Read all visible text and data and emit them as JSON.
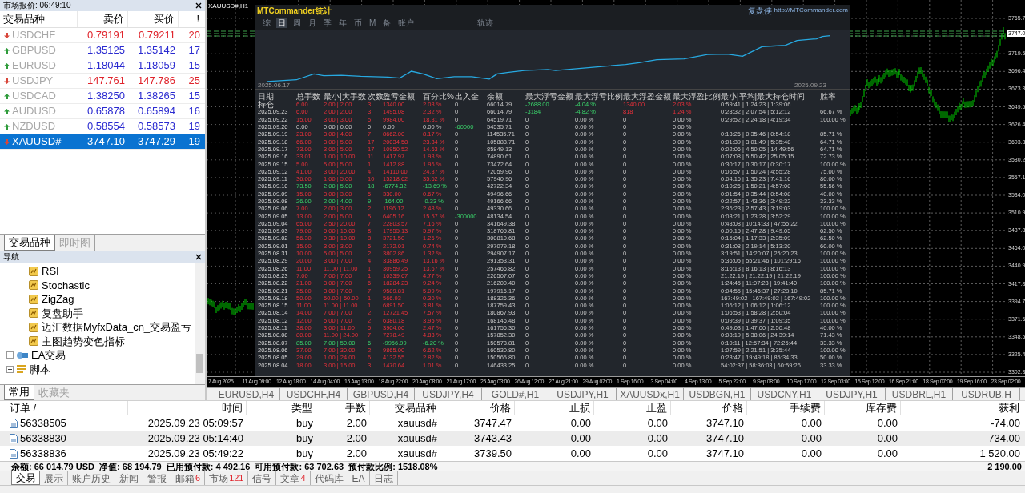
{
  "market_watch": {
    "title": "市场报价: 06:49:10",
    "columns": [
      "交易品种",
      "卖价",
      "买价",
      "!"
    ],
    "rows": [
      {
        "symbol": "USDCHF",
        "bid": "0.79191",
        "ask": "0.79211",
        "spread": "20",
        "rising": false,
        "selected": false
      },
      {
        "symbol": "GBPUSD",
        "bid": "1.35125",
        "ask": "1.35142",
        "spread": "17",
        "rising": true,
        "selected": false
      },
      {
        "symbol": "EURUSD",
        "bid": "1.18044",
        "ask": "1.18059",
        "spread": "15",
        "rising": true,
        "selected": false
      },
      {
        "symbol": "USDJPY",
        "bid": "147.761",
        "ask": "147.786",
        "spread": "25",
        "rising": false,
        "selected": false
      },
      {
        "symbol": "USDCAD",
        "bid": "1.38250",
        "ask": "1.38265",
        "spread": "15",
        "rising": true,
        "selected": false
      },
      {
        "symbol": "AUDUSD",
        "bid": "0.65878",
        "ask": "0.65894",
        "spread": "16",
        "rising": true,
        "selected": false
      },
      {
        "symbol": "NZDUSD",
        "bid": "0.58554",
        "ask": "0.58573",
        "spread": "19",
        "rising": true,
        "selected": false
      },
      {
        "symbol": "XAUUSD#",
        "bid": "3747.10",
        "ask": "3747.29",
        "spread": "19",
        "rising": false,
        "selected": true
      }
    ],
    "tabs": [
      {
        "label": "交易品种",
        "selected": true
      },
      {
        "label": "即时图",
        "selected": false
      }
    ]
  },
  "navigator": {
    "title": "导航",
    "indicators": [
      "RSI",
      "Stochastic",
      "ZigZag",
      "复盘助手",
      "迈汇数据MyfxData_cn_交易盈亏",
      "主图趋势变色指标"
    ],
    "groups": [
      {
        "label": "EA交易",
        "kind": "experts",
        "expanded": false
      },
      {
        "label": "脚本",
        "kind": "scripts",
        "expanded": false
      }
    ],
    "tabs": [
      {
        "label": "常用",
        "selected": true
      },
      {
        "label": "收藏夹",
        "selected": false
      }
    ]
  },
  "chart": {
    "title": "XAUUSD#,H1",
    "current_price": "3747.0",
    "price_labels": [
      "3765.7",
      "3719.5",
      "3696.4",
      "3673.3",
      "3649.5",
      "3626.4",
      "3603.3",
      "3580.2",
      "3557.1",
      "3534.0",
      "3510.9",
      "3487.8",
      "3464.0",
      "3440.9",
      "3417.8",
      "3394.7",
      "3371.6",
      "3348.5",
      "3325.4",
      "3302.3"
    ],
    "time_labels": [
      "7 Aug 2025",
      "11 Aug 09:00",
      "12 Aug 18:00",
      "14 Aug 04:00",
      "15 Aug 13:00",
      "18 Aug 22:00",
      "20 Aug 08:00",
      "21 Aug 17:00",
      "25 Aug 03:00",
      "26 Aug 12:00",
      "27 Aug 21:00",
      "29 Aug 07:00",
      "1 Sep 16:00",
      "3 Sep 04:00",
      "4 Sep 13:00",
      "5 Sep 22:00",
      "9 Sep 08:00",
      "10 Sep 17:00",
      "12 Sep 03:00",
      "15 Sep 12:00",
      "16 Sep 21:00",
      "18 Sep 07:00",
      "19 Sep 16:00",
      "23 Sep 02:00"
    ]
  },
  "stats_panel": {
    "title": "MTCommander统计",
    "brand": "复盘侠",
    "link": "http://MTCommander.com",
    "tabs": [
      {
        "label": "综",
        "selected": false
      },
      {
        "label": "日",
        "selected": true
      },
      {
        "label": "周",
        "selected": false
      },
      {
        "label": "月",
        "selected": false
      },
      {
        "label": "季",
        "selected": false
      },
      {
        "label": "年",
        "selected": false
      },
      {
        "label": "币",
        "selected": false
      },
      {
        "label": "M",
        "selected": false
      },
      {
        "label": "备",
        "selected": false
      },
      {
        "label": "账户",
        "selected": false
      },
      {
        "label": "轨迹",
        "selected": false
      }
    ],
    "curve_start": "2025.06.17",
    "curve_end": "2025.09.23",
    "columns": [
      "日期",
      "总手数",
      "最小|大手数",
      "次数",
      "盈亏金额",
      "百分比%",
      "出入金",
      "余额",
      "最大浮亏金额",
      "最大浮亏比例",
      "最大浮盈金额",
      "最大浮盈比例",
      "最小|平均|最大持仓时间",
      "胜率"
    ],
    "rows": [
      {
        "kind": "gain",
        "floating": true,
        "transfer": false,
        "cells": [
          "持仓",
          "6.00",
          "2.00 | 2.00",
          "3",
          "1340.00",
          "2.03 %",
          "0",
          "66014.79",
          "-2688.00",
          "-4.04 %",
          "1340.00",
          "2.03 %",
          "0:59:41 | 1:24:23 | 1:39:06"
        ]
      },
      {
        "kind": "gain",
        "floating": true,
        "transfer": false,
        "cells": [
          "2025.09.23",
          "6.00",
          "2.00 | 2.00",
          "3",
          "1495.08",
          "2.32 %",
          "0",
          "66014.79",
          "-3184",
          "-4.82 %",
          "818",
          "1.24 %",
          "0:28:32 | 2:07:54 | 5:12:12",
          "66.67 %"
        ]
      },
      {
        "kind": "gain",
        "floating": false,
        "transfer": false,
        "cells": [
          "2025.09.22",
          "15.00",
          "3.00 | 3.00",
          "5",
          "9984.00",
          "18.31 %",
          "0",
          "64519.71",
          "0",
          "0.00 %",
          "0",
          "0.00 %",
          "0:29:52 | 2:24:18 | 4:19:34",
          "100.00 %"
        ]
      },
      {
        "kind": "none",
        "floating": false,
        "transfer": true,
        "cells": [
          "2025.09.20",
          "0.00",
          "0.00 | 0.00",
          "0",
          "0.00",
          "0.00 %",
          "-60000",
          "54535.71",
          "0",
          "0.00 %",
          "0",
          "0.00 %"
        ]
      },
      {
        "kind": "gain",
        "floating": false,
        "transfer": false,
        "cells": [
          "2025.09.19",
          "23.00",
          "3.00 | 4.00",
          "7",
          "8662.00",
          "8.17 %",
          "0",
          "114535.71",
          "0",
          "0.00 %",
          "0",
          "0.00 %",
          "0:13:26 | 0:35:46 | 0:54:18",
          "85.71 %"
        ]
      },
      {
        "kind": "gain",
        "floating": false,
        "transfer": false,
        "cells": [
          "2025.09.18",
          "66.00",
          "3.00 | 5.00",
          "17",
          "20034.58",
          "23.34 %",
          "0",
          "105883.71",
          "0",
          "0.00 %",
          "0",
          "0.00 %",
          "0:01:39 | 3:01:49 | 5:35:48",
          "64.71 %"
        ]
      },
      {
        "kind": "gain",
        "floating": false,
        "transfer": false,
        "cells": [
          "2025.09.17",
          "73.00",
          "3.00 | 5.00",
          "17",
          "10950.52",
          "14.63 %",
          "0",
          "85849.13",
          "0",
          "0.00 %",
          "0",
          "0.00 %",
          "0:02:06 | 4:50:05 | 14:49:56",
          "64.71 %"
        ]
      },
      {
        "kind": "gain",
        "floating": false,
        "transfer": false,
        "cells": [
          "2025.09.16",
          "33.01",
          "1.00 | 10.00",
          "11",
          "1417.97",
          "1.93 %",
          "0",
          "74890.61",
          "0",
          "0.00 %",
          "0",
          "0.00 %",
          "0:07:08 | 5:50:42 | 25:05:15",
          "72.73 %"
        ]
      },
      {
        "kind": "gain",
        "floating": false,
        "transfer": false,
        "cells": [
          "2025.09.15",
          "5.00",
          "5.00 | 5.00",
          "1",
          "1412.88",
          "1.96 %",
          "0",
          "73472.64",
          "0",
          "0.00 %",
          "0",
          "0.00 %",
          "0:30:17 | 0:30:17 | 0:30:17",
          "100.00 %"
        ]
      },
      {
        "kind": "gain",
        "floating": false,
        "transfer": false,
        "cells": [
          "2025.09.12",
          "41.00",
          "3.00 | 20.00",
          "4",
          "14110.00",
          "24.37 %",
          "0",
          "72059.96",
          "0",
          "0.00 %",
          "0",
          "0.00 %",
          "0:06:57 | 1:50:24 | 4:55:28",
          "75.00 %"
        ]
      },
      {
        "kind": "gain",
        "floating": false,
        "transfer": false,
        "cells": [
          "2025.09.11",
          "36.00",
          "1.00 | 5.00",
          "10",
          "15218.62",
          "35.62 %",
          "0",
          "57940.96",
          "0",
          "0.00 %",
          "0",
          "0.00 %",
          "0:04:16 | 1:35:23 | 7:41:16",
          "80.00 %"
        ]
      },
      {
        "kind": "loss",
        "floating": false,
        "transfer": false,
        "cells": [
          "2025.09.10",
          "73.50",
          "2.00 | 5.00",
          "18",
          "-6774.32",
          "-13.69 %",
          "0",
          "42722.34",
          "0",
          "0.00 %",
          "0",
          "0.00 %",
          "0:10:26 | 1:50:21 | 4:57:00",
          "55.56 %"
        ]
      },
      {
        "kind": "gain",
        "floating": false,
        "transfer": false,
        "cells": [
          "2025.09.09",
          "15.00",
          "3.00 | 3.00",
          "5",
          "330.00",
          "0.67 %",
          "0",
          "49496.66",
          "0",
          "0.00 %",
          "0",
          "0.00 %",
          "0:01:54 | 0:35:44 | 0:54:08",
          "40.00 %"
        ]
      },
      {
        "kind": "loss",
        "floating": false,
        "transfer": false,
        "cells": [
          "2025.09.08",
          "26.00",
          "2.00 | 4.00",
          "9",
          "-164.00",
          "-0.33 %",
          "0",
          "49166.66",
          "0",
          "0.00 %",
          "0",
          "0.00 %",
          "0:22:57 | 1:43:36 | 2:49:32",
          "33.33 %"
        ]
      },
      {
        "kind": "gain",
        "floating": false,
        "transfer": false,
        "cells": [
          "2025.09.06",
          "7.00",
          "2.00 | 3.00",
          "2",
          "1196.12",
          "2.48 %",
          "0",
          "49330.66",
          "0",
          "0.00 %",
          "0",
          "0.00 %",
          "2:36:23 | 2:57:43 | 3:19:03",
          "100.00 %"
        ]
      },
      {
        "kind": "gain",
        "floating": false,
        "transfer": true,
        "cells": [
          "2025.09.05",
          "13.00",
          "2.00 | 5.00",
          "5",
          "6405.16",
          "15.57 %",
          "-300000",
          "48134.54",
          "0",
          "0.00 %",
          "0",
          "0.00 %",
          "0:03:21 | 1:23:28 | 3:52:29",
          "100.00 %"
        ]
      },
      {
        "kind": "gain",
        "floating": false,
        "transfer": false,
        "cells": [
          "2025.09.04",
          "65.00",
          "2.50 | 20.00",
          "7",
          "22803.57",
          "7.16 %",
          "0",
          "341649.38",
          "0",
          "0.00 %",
          "0",
          "0.00 %",
          "0:43:08 | 10:14:33 | 47:55:22",
          "100.00 %"
        ]
      },
      {
        "kind": "gain",
        "floating": false,
        "transfer": false,
        "cells": [
          "2025.09.03",
          "79.00",
          "5.00 | 10.00",
          "8",
          "17955.13",
          "5.97 %",
          "0",
          "318765.81",
          "0",
          "0.00 %",
          "0",
          "0.00 %",
          "0:00:15 | 2:47:28 | 9:49:05",
          "62.50 %"
        ]
      },
      {
        "kind": "gain",
        "floating": false,
        "transfer": false,
        "cells": [
          "2025.09.02",
          "56.30",
          "0.30 | 10.00",
          "8",
          "3721.50",
          "1.26 %",
          "0",
          "300810.68",
          "0",
          "0.00 %",
          "0",
          "0.00 %",
          "0:15:04 | 1:17:33 | 2:35:09",
          "62.50 %"
        ]
      },
      {
        "kind": "gain",
        "floating": false,
        "transfer": false,
        "cells": [
          "2025.09.01",
          "15.00",
          "3.00 | 3.00",
          "5",
          "2172.01",
          "0.74 %",
          "0",
          "297079.18",
          "0",
          "0.00 %",
          "0",
          "0.00 %",
          "0:31:08 | 2:19:14 | 5:13:30",
          "60.00 %"
        ]
      },
      {
        "kind": "gain",
        "floating": false,
        "transfer": false,
        "cells": [
          "2025.08.31",
          "10.00",
          "5.00 | 5.00",
          "2",
          "3802.86",
          "1.32 %",
          "0",
          "294907.17",
          "0",
          "0.00 %",
          "0",
          "0.00 %",
          "3:19:51 | 14:20:07 | 25:20:23",
          "100.00 %"
        ]
      },
      {
        "kind": "gain",
        "floating": false,
        "transfer": false,
        "cells": [
          "2025.08.29",
          "20.00",
          "3.00 | 7.00",
          "4",
          "33886.49",
          "13.16 %",
          "0",
          "291353.31",
          "0",
          "0.00 %",
          "0",
          "0.00 %",
          "5:36:05 | 55:21:46 | 101:29:16",
          "100.00 %"
        ]
      },
      {
        "kind": "gain",
        "floating": false,
        "transfer": false,
        "cells": [
          "2025.08.26",
          "11.00",
          "11.00 | 11.00",
          "1",
          "30959.25",
          "13.67 %",
          "0",
          "257466.82",
          "0",
          "0.00 %",
          "0",
          "0.00 %",
          "8:16:13 | 8:16:13 | 8:16:13",
          "100.00 %"
        ]
      },
      {
        "kind": "gain",
        "floating": false,
        "transfer": false,
        "cells": [
          "2025.08.23",
          "7.00",
          "7.00 | 7.00",
          "1",
          "10339.67",
          "4.77 %",
          "0",
          "226507.07",
          "0",
          "0.00 %",
          "0",
          "0.00 %",
          "21:22:19 | 21:22:19 | 21:22:19",
          "100.00 %"
        ]
      },
      {
        "kind": "gain",
        "floating": false,
        "transfer": false,
        "cells": [
          "2025.08.22",
          "21.00",
          "3.00 | 7.00",
          "6",
          "18284.23",
          "9.24 %",
          "0",
          "216200.40",
          "0",
          "0.00 %",
          "0",
          "0.00 %",
          "1:24:45 | 11:07:23 | 19:41:40",
          "100.00 %"
        ]
      },
      {
        "kind": "gain",
        "floating": false,
        "transfer": false,
        "cells": [
          "2025.08.21",
          "25.00",
          "3.00 | 7.00",
          "7",
          "9589.81",
          "5.09 %",
          "0",
          "197916.17",
          "0",
          "0.00 %",
          "0",
          "0.00 %",
          "0:04:55 | 15:46:37 | 27:28:10",
          "85.71 %"
        ]
      },
      {
        "kind": "gain",
        "floating": false,
        "transfer": false,
        "cells": [
          "2025.08.18",
          "50.00",
          "50.00 | 50.00",
          "1",
          "566.93",
          "0.30 %",
          "0",
          "188326.36",
          "0",
          "0.00 %",
          "0",
          "0.00 %",
          "167:49:02 | 167:49:02 | 167:49:02",
          "100.00 %"
        ]
      },
      {
        "kind": "gain",
        "floating": false,
        "transfer": false,
        "cells": [
          "2025.08.15",
          "11.00",
          "11.00 | 11.00",
          "1",
          "6891.50",
          "3.81 %",
          "0",
          "187759.43",
          "0",
          "0.00 %",
          "0",
          "0.00 %",
          "1:06:12 | 1:06:12 | 1:06:12",
          "100.00 %"
        ]
      },
      {
        "kind": "gain",
        "floating": false,
        "transfer": false,
        "cells": [
          "2025.08.14",
          "14.00",
          "7.00 | 7.00",
          "2",
          "12721.45",
          "7.57 %",
          "0",
          "180867.93",
          "0",
          "0.00 %",
          "0",
          "0.00 %",
          "1:06:53 | 1:58:28 | 2:50:04",
          "100.00 %"
        ]
      },
      {
        "kind": "gain",
        "floating": false,
        "transfer": false,
        "cells": [
          "2025.08.12",
          "12.00",
          "5.00 | 7.00",
          "2",
          "6380.18",
          "3.95 %",
          "0",
          "168146.48",
          "0",
          "0.00 %",
          "0",
          "0.00 %",
          "0:09:39 | 0:39:37 | 1:09:35",
          "100.00 %"
        ]
      },
      {
        "kind": "gain",
        "floating": false,
        "transfer": false,
        "cells": [
          "2025.08.11",
          "38.00",
          "3.00 | 11.00",
          "5",
          "3904.00",
          "2.47 %",
          "0",
          "161756.30",
          "0",
          "0.00 %",
          "0",
          "0.00 %",
          "0:49:03 | 1:47:00 | 2:50:48",
          "40.00 %"
        ]
      },
      {
        "kind": "gain",
        "floating": false,
        "transfer": false,
        "cells": [
          "2025.08.08",
          "80.00",
          "11.00 | 24.00",
          "7",
          "7278.49",
          "4.83 %",
          "0",
          "157852.30",
          "0",
          "0.00 %",
          "0",
          "0.00 %",
          "0:08:19 | 5:38:06 | 24:39:14",
          "71.43 %"
        ]
      },
      {
        "kind": "loss",
        "floating": false,
        "transfer": false,
        "cells": [
          "2025.08.07",
          "85.00",
          "7.00 | 50.00",
          "6",
          "-9956.99",
          "-6.20 %",
          "0",
          "150573.81",
          "0",
          "0.00 %",
          "0",
          "0.00 %",
          "0:10:11 | 12:57:34 | 72:25:44",
          "33.33 %"
        ]
      },
      {
        "kind": "gain",
        "floating": false,
        "transfer": false,
        "cells": [
          "2025.08.06",
          "37.00",
          "7.00 | 30.00",
          "2",
          "9865.00",
          "6.62 %",
          "0",
          "160530.80",
          "0",
          "0.00 %",
          "0",
          "0.00 %",
          "1:07:59 | 2:21:51 | 3:35:44",
          "100.00 %"
        ]
      },
      {
        "kind": "gain",
        "floating": false,
        "transfer": false,
        "cells": [
          "2025.08.05",
          "29.00",
          "1.00 | 24.00",
          "6",
          "4132.55",
          "2.82 %",
          "0",
          "150565.80",
          "0",
          "0.00 %",
          "0",
          "0.00 %",
          "0:23:47 | 19:49:18 | 85:34:33",
          "50.00 %"
        ]
      },
      {
        "kind": "gain",
        "floating": false,
        "transfer": false,
        "cells": [
          "2025.08.04",
          "18.00",
          "3.00 | 15.00",
          "3",
          "1470.64",
          "1.01 %",
          "0",
          "146433.25",
          "0",
          "0.00 %",
          "0",
          "0.00 %",
          "54:02:37 | 58:36:03 | 60:59:26",
          "33.33 %"
        ]
      }
    ]
  },
  "chart_tabs": [
    "EURUSD,H4",
    "USDCHF,H4",
    "GBPUSD,H4",
    "USDJPY,H4",
    "GOLD#,H1",
    "USDJPY,H1",
    "XAUUSDx,H1",
    "USDBGN,H1",
    "USDCNY,H1",
    "USDJPY,H1",
    "USDBRL,H1",
    "USDRUB,H"
  ],
  "terminal": {
    "columns": [
      "订单 /",
      "时间",
      "类型",
      "手数",
      "交易品种",
      "价格",
      "止损",
      "止盈",
      "价格",
      "手续费",
      "库存费",
      "获利"
    ],
    "orders": [
      {
        "cells": [
          "56338505",
          "2025.09.23 05:09:57",
          "buy",
          "2.00",
          "xauusd#",
          "3747.47",
          "0.00",
          "0.00",
          "3747.10",
          "0.00",
          "0.00",
          "-74.00"
        ]
      },
      {
        "cells": [
          "56338830",
          "2025.09.23 05:14:40",
          "buy",
          "2.00",
          "xauusd#",
          "3743.43",
          "0.00",
          "0.00",
          "3747.10",
          "0.00",
          "0.00",
          "734.00"
        ]
      },
      {
        "cells": [
          "56338836",
          "2025.09.23 05:49:22",
          "buy",
          "2.00",
          "xauusd#",
          "3739.50",
          "0.00",
          "0.00",
          "3747.10",
          "0.00",
          "0.00",
          "1 520.00"
        ]
      }
    ],
    "summary": "余额: 66 014.79 USD  净值: 68 194.79  已用预付款: 4 492.16  可用预付款: 63 702.63  预付款比例: 1518.08%",
    "summary_profit": "2 190.00",
    "tabs": [
      {
        "label": "交易",
        "selected": true
      },
      {
        "label": "展示",
        "selected": false
      },
      {
        "label": "账户历史",
        "selected": false
      },
      {
        "label": "新闻",
        "selected": false
      },
      {
        "label": "警报",
        "selected": false
      },
      {
        "label": "邮箱",
        "badge": "6",
        "selected": false
      },
      {
        "label": "市场",
        "badge": "121",
        "selected": false
      },
      {
        "label": "信号",
        "selected": false
      },
      {
        "label": "文章",
        "badge": "4",
        "selected": false
      },
      {
        "label": "代码库",
        "selected": false
      },
      {
        "label": "EA",
        "selected": false
      },
      {
        "label": "日志",
        "selected": false
      }
    ]
  }
}
